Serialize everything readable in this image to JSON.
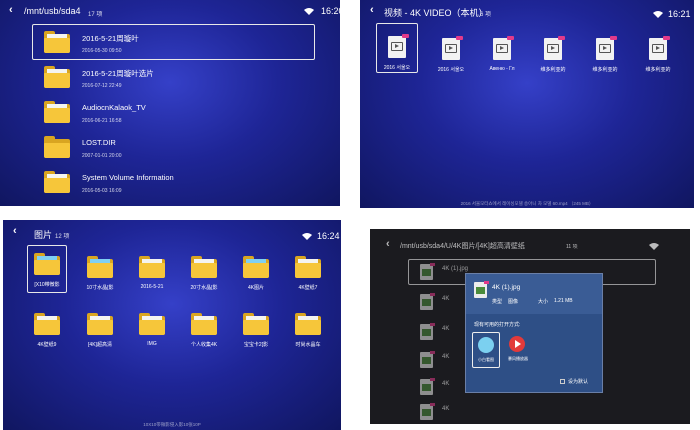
{
  "panels": {
    "browser": {
      "path": "/mnt/usb/sda4",
      "count": "17 项",
      "time": "16:20",
      "items": [
        {
          "name": "2016-5-21周璇叶",
          "date": "2016-05-30 09:50"
        },
        {
          "name": "2016-5-21周璇叶选片",
          "date": "2016-07-12 22:49"
        },
        {
          "name": "AudiocnKalaok_TV",
          "date": "2016-06-21 16:58"
        },
        {
          "name": "LOST.DIR",
          "date": "2007-01-01 20:00"
        },
        {
          "name": "System Volume Information",
          "date": "2016-05-03 16:09"
        }
      ]
    },
    "video": {
      "title": "视频 - 4K VIDEO（本机）",
      "count": "6 项",
      "time": "16:21",
      "items": [
        {
          "label": "2016 서울오"
        },
        {
          "label": "2016 서울오"
        },
        {
          "label": "Авеню - Гл"
        },
        {
          "label": "维多利亚的"
        },
        {
          "label": "维多利亚的"
        },
        {
          "label": "维多利亚的"
        }
      ],
      "footer": "2016 서울모터쇼에서 레이싱모델 송아니 차 모델 60.mp4 （245 MB）"
    },
    "pictures": {
      "title": "图片",
      "count": "12 项",
      "time": "16:24",
      "items": [
        {
          "label": "[X10带微影"
        },
        {
          "label": "10寸水晶[影"
        },
        {
          "label": "2016-5-21"
        },
        {
          "label": "20寸水晶[影"
        },
        {
          "label": "4K图片"
        },
        {
          "label": "4K壁纸7"
        },
        {
          "label": "4K壁纸9"
        },
        {
          "label": "[4K]超高清"
        },
        {
          "label": "IMG"
        },
        {
          "label": "个人收集4K"
        },
        {
          "label": "宝宝卡2[影"
        },
        {
          "label": "时尚水晶车"
        }
      ],
      "footer": "10X10带微影侵入影10张10P"
    },
    "openwith": {
      "path": "/mnt/usb/sda4/U/4K图片/[4K]超高清壁纸",
      "count": "11 项",
      "file_name": "4K (1).jpg",
      "bg_items": [
        {
          "name": "4K (1).jpg"
        },
        {
          "name": "4K"
        },
        {
          "name": "4K"
        },
        {
          "name": "4K"
        },
        {
          "name": "4K"
        },
        {
          "name": "4K"
        }
      ],
      "dialog": {
        "title": "4K (1).jpg",
        "type_label": "类型",
        "type_value": "图像",
        "size_label": "大小",
        "size_value": "1.21 MB",
        "prompt": "现有可用的打开方式:",
        "apps": [
          {
            "label": "小白看图"
          },
          {
            "label": "暴风播放器"
          }
        ],
        "default_label": "设为默认"
      }
    }
  },
  "colors": {
    "accent_blue": "#1e2596",
    "folder_yellow": "#f6c63a",
    "dialog_blue": "#2e4f86"
  }
}
